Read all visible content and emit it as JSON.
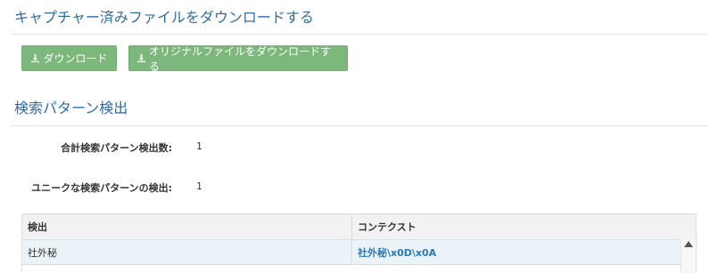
{
  "captured_files": {
    "title": "キャプチャー済みファイルをダウンロードする",
    "download_label": "ダウンロード",
    "download_original_label": "オリジナルファイルをダウンロードする"
  },
  "pattern_detection": {
    "title": "検索パターン検出",
    "stats": [
      {
        "label": "合計検索パターン検出数:",
        "value": "1"
      },
      {
        "label": "ユニークな検索パターンの検出:",
        "value": "1"
      }
    ],
    "table": {
      "headers": [
        "検出",
        "コンテクスト"
      ],
      "rows": [
        {
          "detection": "社外秘",
          "context": "社外秘\\x0D\\x0A"
        }
      ]
    }
  },
  "icons": {
    "download": "download-icon",
    "scroll_up": "scroll-up-arrow-icon"
  },
  "colors": {
    "title": "#2e6da4",
    "button": "#7cb87c",
    "link": "#2a78b6",
    "row_highlight": "#eaf3f8"
  }
}
